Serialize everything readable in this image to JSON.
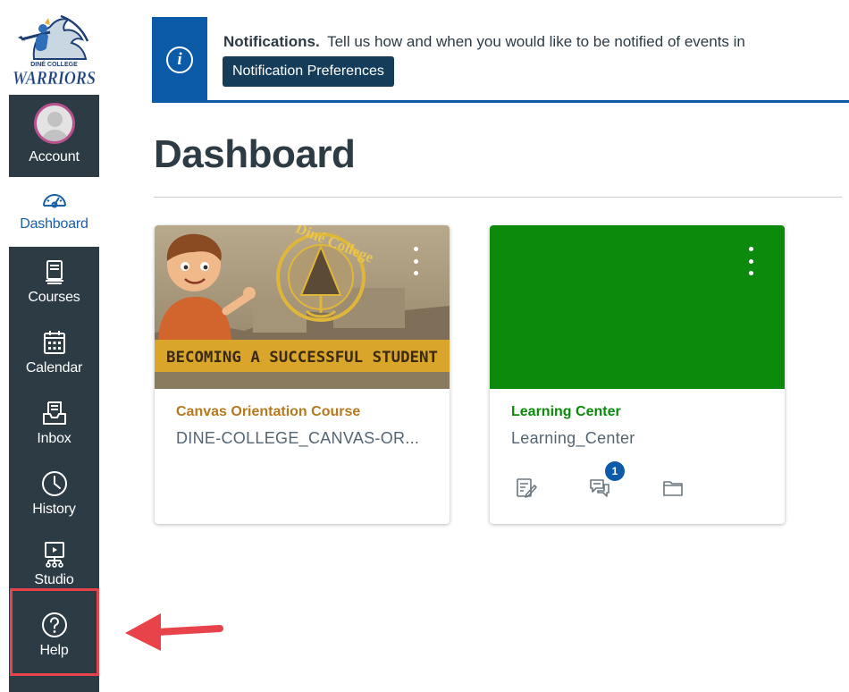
{
  "window": {
    "title": "Dashboard"
  },
  "nav": {
    "logo": {
      "top_text": "DINÉ COLLEGE",
      "word": "WARRIORS",
      "icon": "warriors-logo"
    },
    "items": [
      {
        "id": "account",
        "label": "Account",
        "icon": "user-avatar-icon",
        "active": false
      },
      {
        "id": "dashboard",
        "label": "Dashboard",
        "icon": "speedometer-icon",
        "active": true
      },
      {
        "id": "courses",
        "label": "Courses",
        "icon": "courses-icon",
        "active": false
      },
      {
        "id": "calendar",
        "label": "Calendar",
        "icon": "calendar-icon",
        "active": false
      },
      {
        "id": "inbox",
        "label": "Inbox",
        "icon": "inbox-icon",
        "active": false
      },
      {
        "id": "history",
        "label": "History",
        "icon": "clock-icon",
        "active": false
      },
      {
        "id": "studio",
        "label": "Studio",
        "icon": "studio-icon",
        "active": false
      },
      {
        "id": "help",
        "label": "Help",
        "icon": "help-icon",
        "active": false
      }
    ]
  },
  "notification": {
    "title": "Notifications.",
    "message": "Tell us how and when you would like to be notified of events in",
    "button_label": "Notification Preferences",
    "icon": "info-icon"
  },
  "dashboard": {
    "title": "Dashboard"
  },
  "cards": [
    {
      "name": "Canvas Orientation Course",
      "code": "DINE-COLLEGE_CANVAS-OR...",
      "color": "#b5791f",
      "hero_banner_text": "BECOMING A SUCCESSFUL STUDENT",
      "hero_seal_text": "Diné College",
      "actions": []
    },
    {
      "name": "Learning Center",
      "code": "Learning_Center",
      "color": "#0b8a0b",
      "actions": [
        {
          "icon": "assignments-icon"
        },
        {
          "icon": "discussions-icon",
          "badge": "1"
        },
        {
          "icon": "files-icon"
        }
      ]
    }
  ],
  "annotation": {
    "highlight_color": "#e8424a"
  }
}
